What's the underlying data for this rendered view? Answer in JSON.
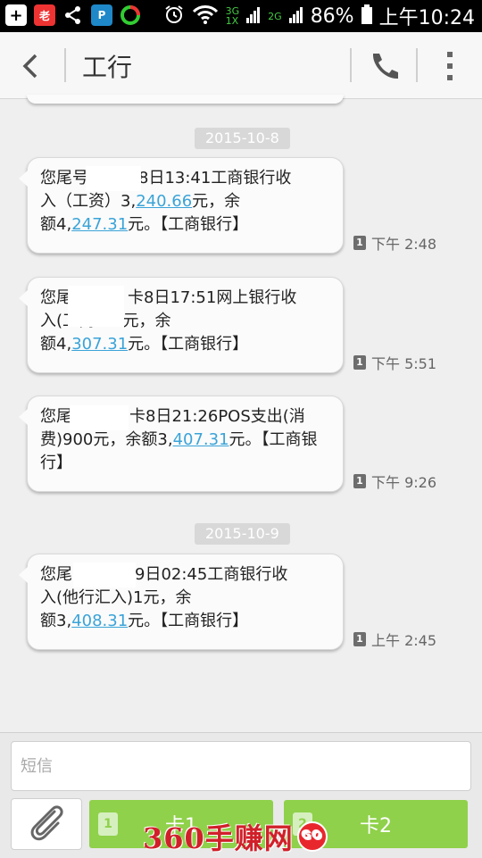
{
  "status_bar": {
    "icons": [
      "add-icon",
      "laoban-app-icon",
      "share-icon",
      "app-icon",
      "browser-icon",
      "alarm-icon",
      "wifi-icon",
      "signal-icon"
    ],
    "net1": "3G",
    "net1b": "1X",
    "net2": "2G",
    "battery": "86%",
    "time": "上午10:24"
  },
  "header": {
    "title": "工行"
  },
  "dates": [
    "2015-10-8",
    "2015-10-9"
  ],
  "messages": [
    {
      "pre1": "您尾号",
      "mid1": "8日13:41工商银行收",
      "line2_pre": "入（工资）3,",
      "amount1": "240.66",
      "line2_post": "元，余",
      "line3_pre": "额4,",
      "amount2": "247.31",
      "line3_post": "元。【工商银行】",
      "time": "下午 2:48",
      "sim": "1"
    },
    {
      "pre1": "您尾",
      "mid1": "卡8日17:51网上银行收",
      "line2_pre": "入(工商",
      "line2_post": "0元，余",
      "line3_pre": "额4,",
      "amount2": "307.31",
      "line3_post": "元。【工商银行】",
      "time": "下午 5:51",
      "sim": "1"
    },
    {
      "pre1": "您尾",
      "mid1": "卡8日21:26POS支出(消",
      "line2_pre": "费)900元，余额3,",
      "amount2": "407.31",
      "line2_post": "元。【工商银",
      "line3_pre": "行】",
      "time": "下午 9:26",
      "sim": "1"
    },
    {
      "pre1": "您尾",
      "mid1": "9日02:45工商银行收",
      "line2_pre": "入(他行汇入)1元，余",
      "line3_pre": "额3,",
      "amount2": "408.31",
      "line3_post": "元。【工商银行】",
      "time": "上午 2:45",
      "sim": "1"
    }
  ],
  "compose": {
    "placeholder": "短信",
    "send1_label": "卡1",
    "send2_label": "卡2",
    "send1_sim": "1",
    "send2_sim": "2"
  },
  "watermark": {
    "text": "360手赚网",
    "badge": "GO"
  },
  "colors": {
    "accent_green": "#8fd14a",
    "link_blue": "#3aa3d8"
  }
}
